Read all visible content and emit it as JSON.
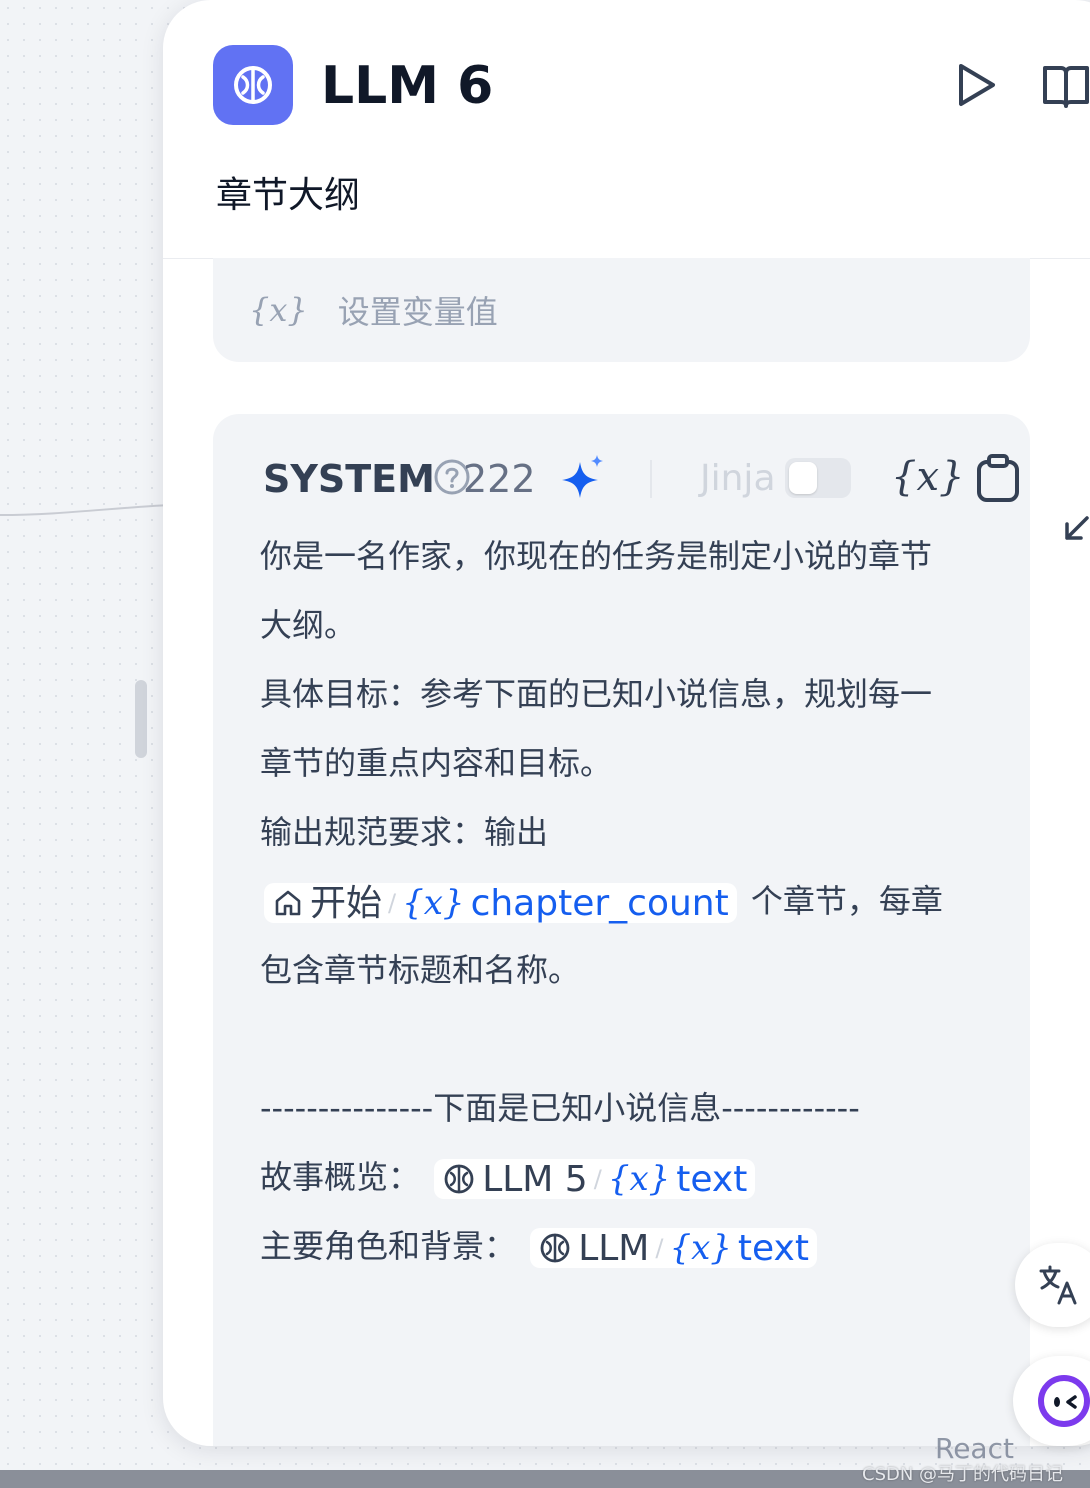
{
  "node": {
    "title": "LLM 6",
    "description": "章节大纲",
    "accent_color": "#6172f3"
  },
  "variable_row": {
    "icon": "{x}",
    "label": "设置变量值"
  },
  "prompt": {
    "role_label": "SYSTEM",
    "token_count": "222",
    "jinja_label": "Jinja",
    "jinja_enabled": false,
    "insert_variable_icon": "{x}",
    "lines": {
      "l1": "你是一名作家，你现在的任务是制定小说的章节",
      "l2": "大纲。",
      "l3": "具体目标：参考下面的已知小说信息，规划每一",
      "l4": "章节的重点内容和目标。",
      "l5": "输出规范要求：输出",
      "l6_suffix": " 个章节，每章",
      "l7": "包含章节标题和名称。",
      "l8": "---------------下面是已知小说信息------------",
      "l9_prefix": "故事概览：",
      "l10_prefix": "主要角色和背景："
    },
    "var_refs": {
      "chapter_count": {
        "node": "开始",
        "separator": "/",
        "icon": "{x}",
        "variable": "chapter_count"
      },
      "story_overview": {
        "node": "LLM 5",
        "separator": "/",
        "icon": "{x}",
        "variable": "text"
      },
      "characters": {
        "node": "LLM",
        "separator": "/",
        "icon": "{x}",
        "variable": "text"
      }
    },
    "variable_color": "#155eef"
  },
  "overlay": {
    "react_text": "React",
    "watermark": "CSDN @马丁的代码日记"
  },
  "icons": [
    "brain-icon",
    "play-icon",
    "book-icon",
    "help-circle-icon",
    "sparkle-icon",
    "variable-icon",
    "copy-icon",
    "expand-icon",
    "home-icon",
    "translate-icon",
    "bot-icon"
  ]
}
